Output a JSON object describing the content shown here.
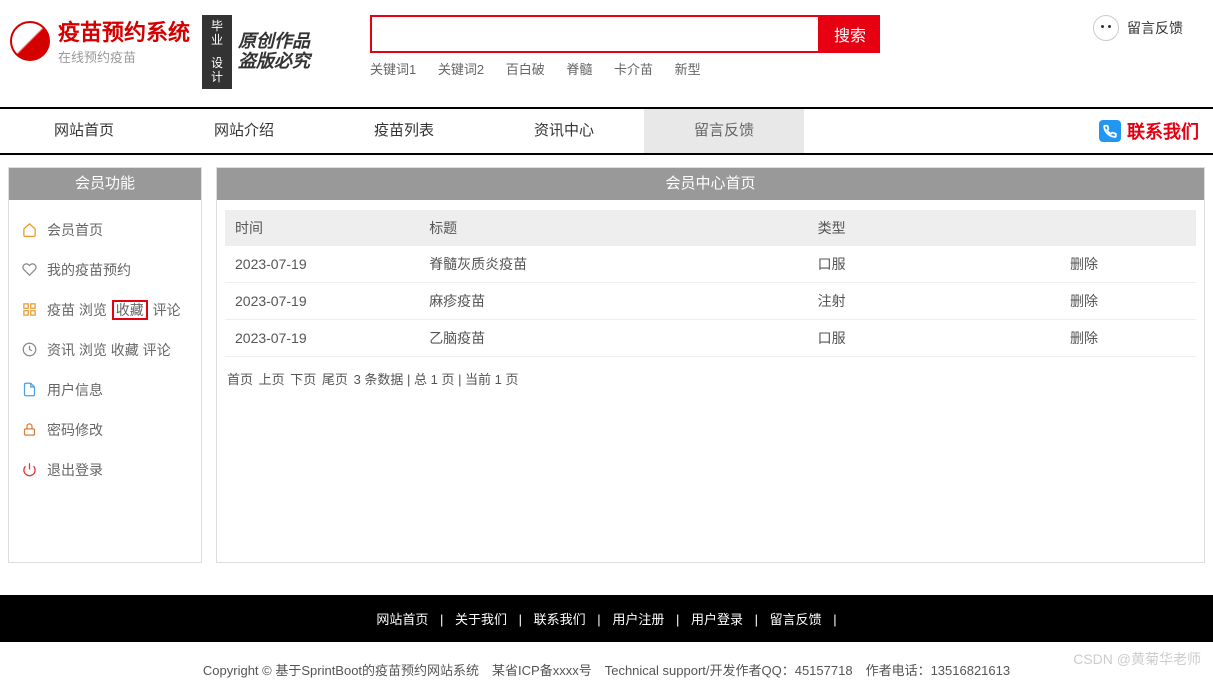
{
  "header": {
    "title": "疫苗预约系统",
    "subtitle": "在线预约疫苗",
    "badge_line1": "毕业",
    "badge_line2": "设计",
    "calli_line1": "原创作品",
    "calli_line2": "盗版必究",
    "search_placeholder": "",
    "search_button": "搜索",
    "keywords": [
      "关键词1",
      "关键词2",
      "百白破",
      "脊髓",
      "卡介苗",
      "新型"
    ],
    "feedback_label": "留言反馈"
  },
  "nav": {
    "items": [
      "网站首页",
      "网站介绍",
      "疫苗列表",
      "资讯中心",
      "留言反馈"
    ],
    "contact": "联系我们"
  },
  "sidebar": {
    "title": "会员功能",
    "items": [
      {
        "icon": "home-icon",
        "label": "会员首页"
      },
      {
        "icon": "heart-icon",
        "label": "我的疫苗预约"
      },
      {
        "icon": "grid-icon",
        "label_parts": [
          "疫苗 浏览 ",
          "收藏",
          " 评论"
        ],
        "highlight_index": 1
      },
      {
        "icon": "clock-icon",
        "label": "资讯 浏览 收藏 评论"
      },
      {
        "icon": "doc-icon",
        "label": "用户信息"
      },
      {
        "icon": "lock-icon",
        "label": "密码修改"
      },
      {
        "icon": "power-icon",
        "label": "退出登录"
      }
    ]
  },
  "main": {
    "title": "会员中心首页",
    "columns": [
      "时间",
      "标题",
      "类型",
      ""
    ],
    "rows": [
      {
        "date": "2023-07-19",
        "title": "脊髓灰质炎疫苗",
        "type": "口服",
        "action": "删除"
      },
      {
        "date": "2023-07-19",
        "title": "麻疹疫苗",
        "type": "注射",
        "action": "删除"
      },
      {
        "date": "2023-07-19",
        "title": "乙脑疫苗",
        "type": "口服",
        "action": "删除"
      }
    ],
    "pager": {
      "first": "首页",
      "prev": "上页",
      "next": "下页",
      "last": "尾页",
      "summary": "3 条数据 | 总 1 页 | 当前 1 页"
    }
  },
  "footer": {
    "links": [
      "网站首页",
      "关于我们",
      "联系我们",
      "用户注册",
      "用户登录",
      "留言反馈"
    ],
    "sep": "|",
    "copyright": "Copyright © 基于SprintBoot的疫苗预约网站系统　某省ICP备xxxx号　Technical support/开发作者QQ：45157718　作者电话：13516821613"
  },
  "watermark": "CSDN @黄菊华老师"
}
